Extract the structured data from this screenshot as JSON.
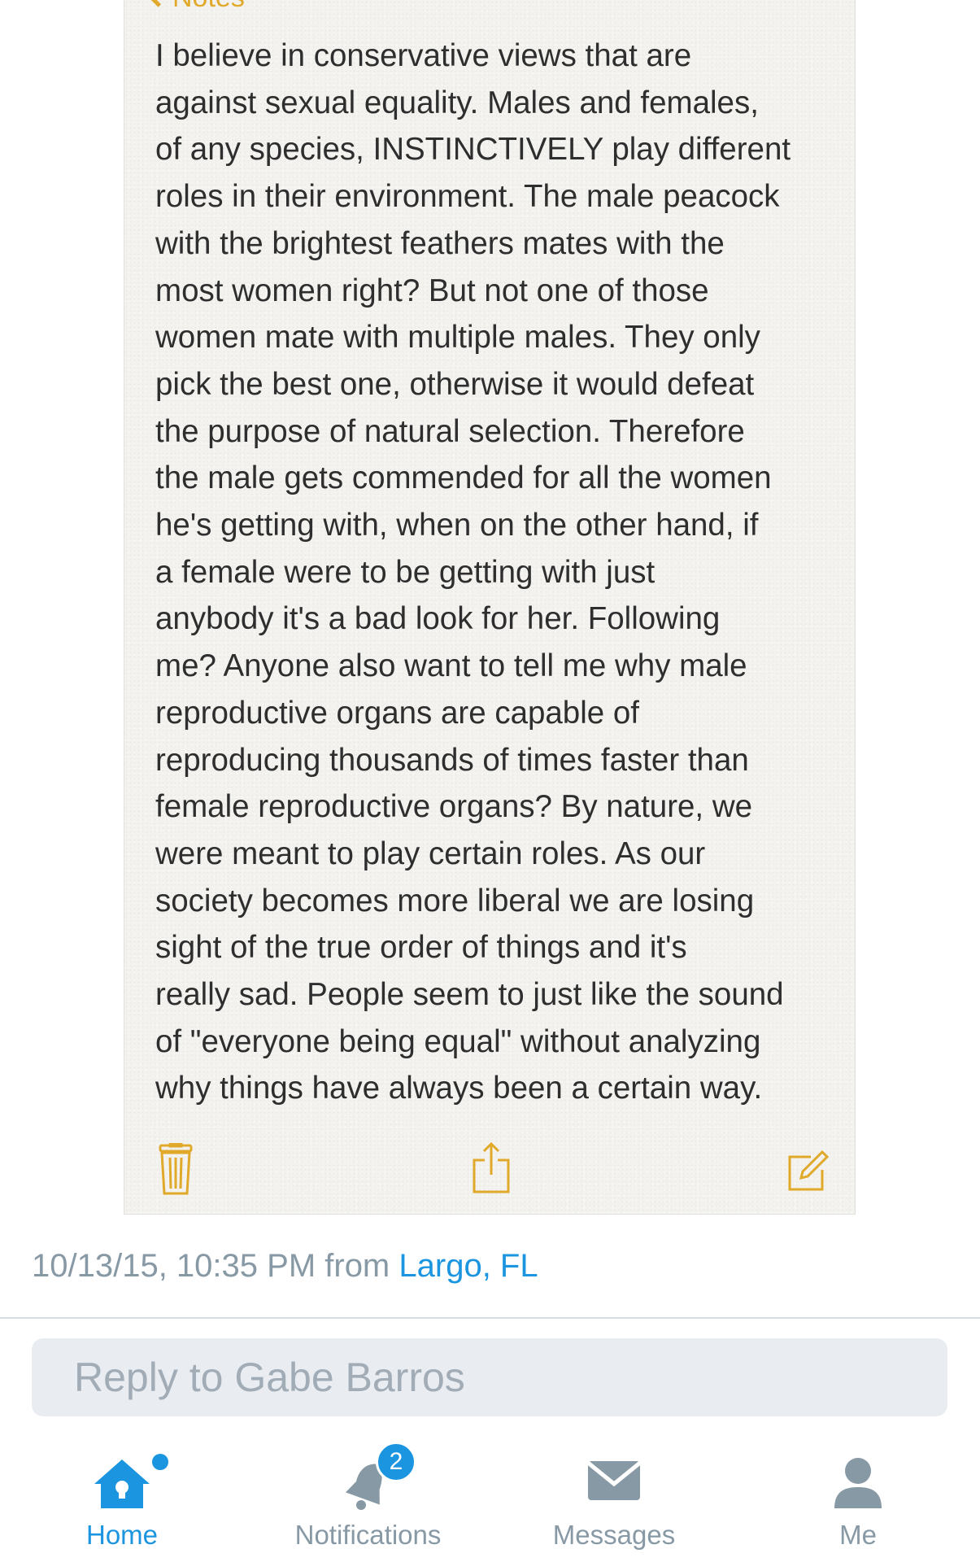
{
  "note": {
    "back_label": "Notes",
    "body": "I believe in conservative views that are\nagainst sexual equality. Males and females,\nof any species, INSTINCTIVELY play different\nroles in their environment. The male peacock\nwith the brightest feathers mates with the\nmost women right? But not one of those\nwomen mate with multiple males. They only\npick the best one, otherwise it would defeat\nthe purpose of natural selection. Therefore\nthe male gets commended for all the women\nhe's getting with, when on the other hand, if\na female were to be getting with just\nanybody it's a bad look for her. Following\nme? Anyone also want to tell me why male\nreproductive organs are capable of\nreproducing thousands of times faster than\nfemale reproductive organs? By nature, we\nwere meant to play certain roles. As our\nsociety becomes more liberal we are losing\nsight of the true order of things and it's\nreally sad. People seem to just like the sound\nof \"everyone being equal\" without analyzing\nwhy things have always been a certain way.",
    "toolbar_icons": [
      "trash-icon",
      "share-icon",
      "compose-icon"
    ],
    "accent_color": "#e0a92a"
  },
  "tweet_meta": {
    "timestamp": "10/13/15, 10:35 PM from",
    "location": "Largo, FL"
  },
  "reply": {
    "placeholder": "Reply to Gabe Barros"
  },
  "tab_bar": {
    "items": [
      {
        "label": "Home",
        "icon": "home-icon",
        "active": true,
        "new_indicator": true
      },
      {
        "label": "Notifications",
        "icon": "bell-icon",
        "badge": "2"
      },
      {
        "label": "Messages",
        "icon": "envelope-icon"
      },
      {
        "label": "Me",
        "icon": "person-icon"
      }
    ]
  },
  "colors": {
    "link": "#1b95e0",
    "muted": "#8899a6",
    "reply_bg": "#e9edf1"
  }
}
